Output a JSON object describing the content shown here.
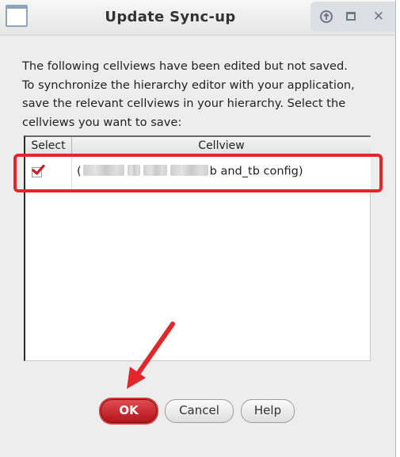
{
  "window": {
    "title": "Update Sync-up",
    "controls": {
      "up_icon": "arrow-up-icon",
      "maximize_icon": "maximize-icon",
      "close_glyph": "✕"
    }
  },
  "description": "The following cellviews have been edited but not saved.\nTo synchronize the hierarchy editor with your application,\nsave the relevant cellviews in your hierarchy. Select the\ncellviews you want to save:",
  "table": {
    "columns": [
      "Select",
      "Cellview"
    ],
    "rows": [
      {
        "selected": true,
        "cellview_prefix": "(",
        "cellview_suffix": "b and_tb config)"
      }
    ]
  },
  "buttons": {
    "ok": "OK",
    "cancel": "Cancel",
    "help": "Help"
  },
  "colors": {
    "annotation_red": "#e3262b",
    "ok_button": "#c41f25"
  }
}
